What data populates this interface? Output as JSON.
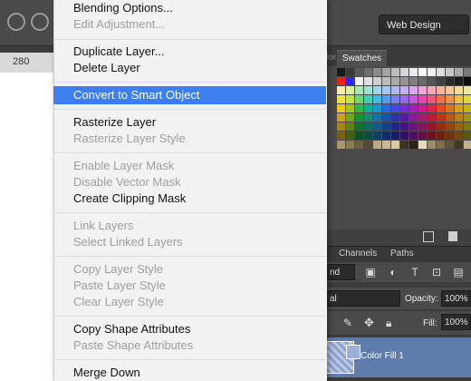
{
  "topbar": {
    "workspace_label": "Web Design"
  },
  "ruler": {
    "label": "280"
  },
  "swatches_panel": {
    "tabs": [
      "lor",
      "Swatches"
    ]
  },
  "swatch_colors": [
    [
      "#1a1a1a",
      "#3a3a3a",
      "#5a5a5a",
      "#6e6e6e",
      "#8a8a8a",
      "#a3a3a3",
      "#bdbdbd",
      "#d5d5d5",
      "#ebebeb",
      "#ffffff",
      "#f0f0f0",
      "#dedede",
      "#c8c8c8",
      "#aaaaaa",
      "#7a7a7a"
    ],
    [
      "#ff1a1a",
      "#2a2aff",
      "#f2f2f2",
      "#e0e0e0",
      "#cfcfcf",
      "#bcbcbc",
      "#a8a8a8",
      "#959595",
      "#7f7f7f",
      "#6a6a6a",
      "#555555",
      "#404040",
      "#2c2c2c",
      "#1c1c1c",
      "#0f0f0f"
    ],
    [
      "#f7e9a8",
      "#d8f0a0",
      "#a8e6b5",
      "#9ee0d4",
      "#9fd6ea",
      "#a6c8f0",
      "#b3b6f0",
      "#c6aef0",
      "#dcaaea",
      "#efa8d6",
      "#f5a8b8",
      "#f5b29a",
      "#f5c696",
      "#f0de9a",
      "#e8e6a0"
    ],
    [
      "#f2e24a",
      "#c4e04a",
      "#6fd47a",
      "#4acbb5",
      "#4ab8e0",
      "#5a9ae8",
      "#7a80e8",
      "#9a6ae8",
      "#c45ad8",
      "#e04aa8",
      "#e85a78",
      "#e8744a",
      "#e8964a",
      "#e8c04a",
      "#d8d84a"
    ],
    [
      "#e8c81e",
      "#9ac81e",
      "#2eb84a",
      "#1aa896",
      "#1a96d0",
      "#2a6ad8",
      "#4a48d8",
      "#7a30d0",
      "#a81eb8",
      "#c81e86",
      "#d8284a",
      "#d8501e",
      "#d8781e",
      "#d8a01e",
      "#b8b81e"
    ],
    [
      "#c8a41a",
      "#7aa41a",
      "#1a9038",
      "#148a7a",
      "#1474a8",
      "#1a50b0",
      "#3030b0",
      "#5a1aa8",
      "#8a1a98",
      "#a81a6a",
      "#b81a38",
      "#b83a14",
      "#b85a14",
      "#b88014",
      "#98981a"
    ],
    [
      "#a68418",
      "#5a8418",
      "#147030",
      "#0f6a5e",
      "#0f5a86",
      "#14408a",
      "#24248a",
      "#461486",
      "#6a1478",
      "#86145a",
      "#96142c",
      "#962e0f",
      "#96480f",
      "#96660f",
      "#7a7a14"
    ],
    [
      "#7a6014",
      "#406014",
      "#0f5024",
      "#0a4c44",
      "#0a4062",
      "#0f2e66",
      "#1a1a66",
      "#320f62",
      "#4c0f58",
      "#620f42",
      "#6e0f20",
      "#6e220a",
      "#6e340a",
      "#6e4a0a",
      "#5a5a0f"
    ],
    [
      "#a89870",
      "#8a7a58",
      "#6e6044",
      "#544a36",
      "#b8a888",
      "#c8b898",
      "#d8c8a8",
      "#3a3428",
      "#282418",
      "#e8dcc0",
      "#9a8c6c",
      "#7c6e52",
      "#5e5440",
      "#40382a",
      "#c0b08c"
    ]
  ],
  "layers_panel": {
    "tabs": {
      "channels": "Channels",
      "paths": "Paths"
    },
    "filter_kind": "nd",
    "blend_mode": "al",
    "opacity_label": "Opacity:",
    "opacity_value": "100%",
    "fill_label": "Fill:",
    "fill_value": "100%",
    "layer_name": "Color Fill 1"
  },
  "menu": {
    "items": [
      {
        "label": "Blending Options...",
        "enabled": true
      },
      {
        "label": "Edit Adjustment...",
        "enabled": false
      },
      {
        "label": "Duplicate Layer...",
        "enabled": true
      },
      {
        "label": "Delete Layer",
        "enabled": true
      },
      {
        "label": "Convert to Smart Object",
        "enabled": true,
        "highlighted": true
      },
      {
        "label": "Rasterize Layer",
        "enabled": true
      },
      {
        "label": "Rasterize Layer Style",
        "enabled": false
      },
      {
        "label": "Enable Layer Mask",
        "enabled": false
      },
      {
        "label": "Disable Vector Mask",
        "enabled": false
      },
      {
        "label": "Create Clipping Mask",
        "enabled": true
      },
      {
        "label": "Link Layers",
        "enabled": false
      },
      {
        "label": "Select Linked Layers",
        "enabled": false
      },
      {
        "label": "Copy Layer Style",
        "enabled": false
      },
      {
        "label": "Paste Layer Style",
        "enabled": false
      },
      {
        "label": "Clear Layer Style",
        "enabled": false
      },
      {
        "label": "Copy Shape Attributes",
        "enabled": true
      },
      {
        "label": "Paste Shape Attributes",
        "enabled": false
      },
      {
        "label": "Merge Down",
        "enabled": true
      }
    ]
  }
}
